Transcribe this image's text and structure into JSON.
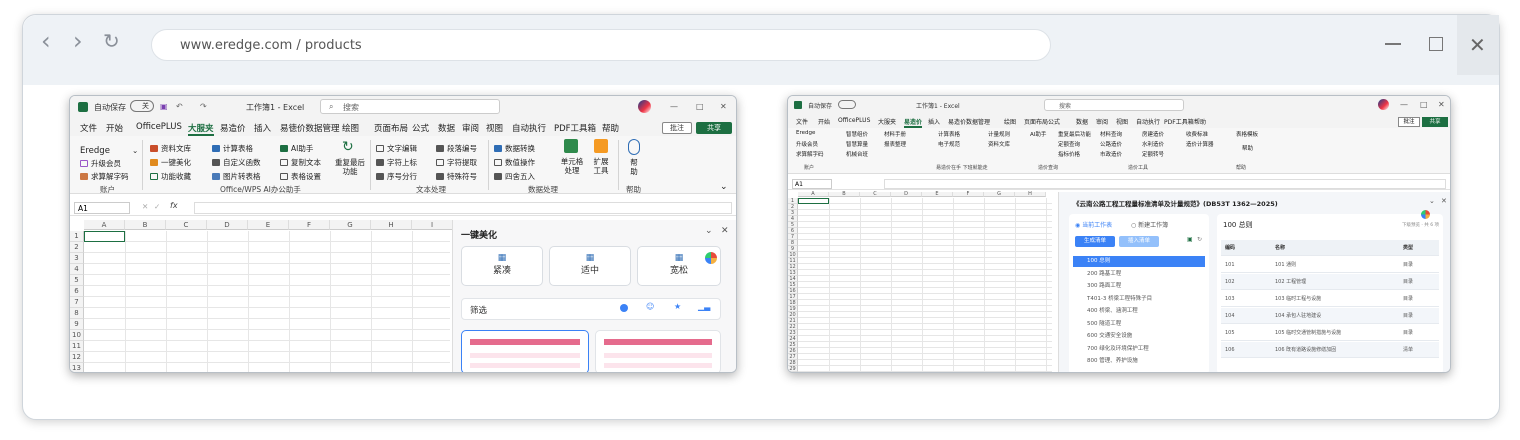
{
  "browser": {
    "url": "www.eredge.com / products",
    "back_icon": "‹",
    "forward_icon": "›",
    "reload_icon": "↻"
  },
  "left_window": {
    "autosave_label": "自动保存",
    "autosave_state": "关",
    "file_title": "工作簿1 - Excel",
    "search_placeholder": "搜索",
    "menu": [
      "文件",
      "开始",
      "OfficePLUS",
      "大服夹",
      "易造价",
      "插入",
      "易徳价数据管理",
      "绘图",
      "页面布局",
      "公式",
      "数据",
      "审阅",
      "视图",
      "自动执行",
      "PDF工具箱",
      "帮助"
    ],
    "active_menu": "大服夹",
    "comment_btn": "批注",
    "share_btn": "共享",
    "ribbon": {
      "account": {
        "items": [
          "Eredge",
          "升级会员",
          "求算解字码"
        ],
        "group": "账户"
      },
      "ai": {
        "items": [
          "资料文库",
          "一键美化",
          "功能收藏",
          "计算表格",
          "自定义函数",
          "图片转表格",
          "AI助手",
          "复制文本",
          "表格设置"
        ],
        "big": "重复最后功能",
        "group": "Office/WPS AI办公助手"
      },
      "text": {
        "items": [
          "文字编辑",
          "字符上标",
          "序号分行",
          "段落编号",
          "字符提取",
          "特殊符号"
        ],
        "group": "文本处理"
      },
      "data": {
        "items": [
          "数据转换",
          "数值操作",
          "四舍五入"
        ],
        "big1": "单元格处理",
        "big2": "扩展工具",
        "group": "数据处理"
      },
      "help": {
        "big": "帮助",
        "group": "帮助"
      }
    },
    "namebox": "A1",
    "fx": "fx",
    "columns": [
      "A",
      "B",
      "C",
      "D",
      "E",
      "F",
      "G",
      "H",
      "I"
    ],
    "rows": [
      "1",
      "2",
      "3",
      "4",
      "5",
      "6",
      "7",
      "8",
      "9",
      "10",
      "11",
      "12",
      "13"
    ],
    "pane": {
      "title": "一键美化",
      "options": [
        "紧凑",
        "适中",
        "宽松"
      ],
      "filter_label": "筛选"
    }
  },
  "right_window": {
    "autosave_label": "自动保存",
    "file_title": "工作簿1 - Excel",
    "search_placeholder": "搜索",
    "menu": [
      "文件",
      "开始",
      "OfficePLUS",
      "大服夹",
      "易造价",
      "插入",
      "易造价数据管理",
      "绘图",
      "页面布局",
      "公式",
      "数据",
      "审阅",
      "视图",
      "自动执行",
      "PDF工具箱",
      "帮助"
    ],
    "active_menu": "易造价",
    "comment_btn": "批注",
    "share_btn": "共享",
    "ribbon_items": [
      "Eredge",
      "升级会员",
      "求算解字码",
      "智慧组价",
      "智慧算量",
      "机械台班",
      "材料手册",
      "报表整理",
      "计算表格",
      "电子规范",
      "计量规则",
      "资料文库",
      "AI助手",
      "重复最后功能",
      "定额查询",
      "指标价格",
      "材料查询",
      "公路造价",
      "市政造价",
      "房建造价",
      "水利造价",
      "定额转号",
      "收费标准",
      "造价计算器",
      "表格模板",
      "帮助"
    ],
    "group_labels": [
      "账户",
      "易造价在手 下班就能走",
      "造价查询",
      "造价工具",
      "帮助"
    ],
    "namebox": "A1",
    "columns": [
      "A",
      "B",
      "C",
      "D",
      "E",
      "F",
      "G",
      "H"
    ],
    "rows": [
      "1",
      "2",
      "3",
      "4",
      "5",
      "6",
      "7",
      "8",
      "9",
      "10",
      "11",
      "12",
      "13",
      "14",
      "15",
      "16",
      "17",
      "18",
      "19",
      "20",
      "21",
      "22",
      "23",
      "24",
      "25",
      "26",
      "27",
      "28",
      "29",
      "30"
    ],
    "pane": {
      "title": "《云南公路工程工程量标准清单及计量规范》(DB53T 1362—2025)",
      "radio1": "当前工作表",
      "radio2": "新建工作簿",
      "btn_generate": "生成清单",
      "btn_insert": "插入清单",
      "tree": [
        "100 总则",
        "200 路基工程",
        "300 路面工程",
        "T401-3 桥梁工程特殊子目",
        "400 桥梁、涵洞工程",
        "500 隧道工程",
        "600 交通安全设施",
        "700 绿化及环境保护工程",
        "800 管理、养护设施"
      ],
      "table_title": "100 总则",
      "table_hint": "下级预览 · 共 6 项",
      "headers": [
        "编码",
        "名称",
        "类型"
      ],
      "rows": [
        [
          "101",
          "101 通则",
          "目录"
        ],
        [
          "102",
          "102 工程管理",
          "目录"
        ],
        [
          "103",
          "103 临时工程与设施",
          "目录"
        ],
        [
          "104",
          "104 承包人驻地建设",
          "目录"
        ],
        [
          "105",
          "105 临时交通管制措施与设施",
          "目录"
        ],
        [
          "106",
          "106 既有道路设施修缮加固",
          "清单"
        ]
      ]
    }
  },
  "colors": {
    "excel_green": "#1d6f42",
    "accent_blue": "#3b82f6",
    "pink": "#e56b8d"
  }
}
